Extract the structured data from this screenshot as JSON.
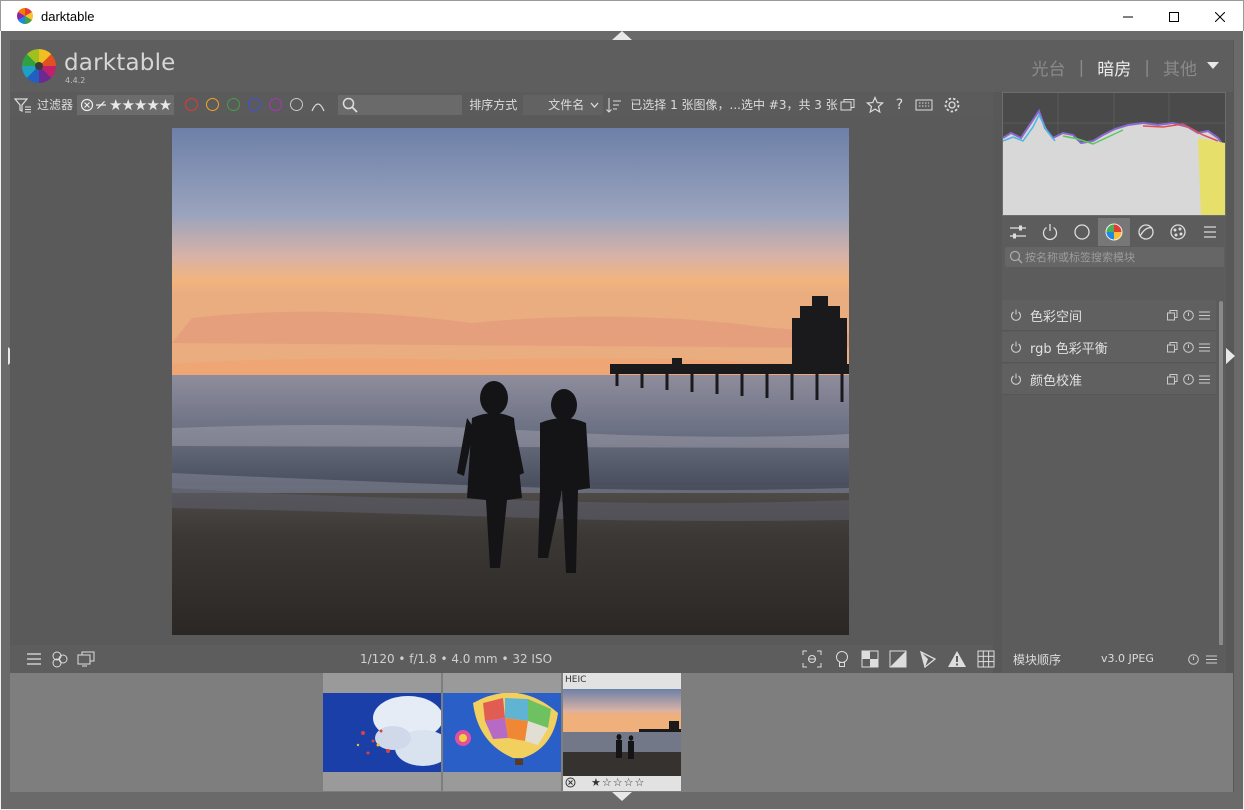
{
  "window": {
    "title": "darktable"
  },
  "header": {
    "logo_text": "darktable",
    "version": "4.4.2",
    "views": [
      {
        "label": "光台",
        "active": false
      },
      {
        "label": "暗房",
        "active": true
      },
      {
        "label": "其他",
        "active": false
      }
    ],
    "separator": "|"
  },
  "toolbar": {
    "filter_label": "过滤器",
    "rating_stars": "★★★★★",
    "search_placeholder": "",
    "sort_label": "排序方式",
    "sort_value": "文件名",
    "selection_info": "已选择 1 张图像，...选中 #3，共 3 张",
    "color_labels": [
      {
        "name": "red",
        "color": "#e53935"
      },
      {
        "name": "yellow",
        "color": "#f5a623"
      },
      {
        "name": "green",
        "color": "#43a047"
      },
      {
        "name": "blue",
        "color": "#3f51e5"
      },
      {
        "name": "purple",
        "color": "#b030c0"
      },
      {
        "name": "gray",
        "color": "#c8c8c8"
      }
    ]
  },
  "center": {
    "exif": "1/120 • f/1.8 • 4.0 mm • 32 ISO"
  },
  "right_panel": {
    "search_placeholder": "按名称或标签搜索模块",
    "modules": [
      {
        "label": "色彩空间"
      },
      {
        "label": "rgb 色彩平衡"
      },
      {
        "label": "颜色校准"
      }
    ],
    "module_order_label": "模块顺序",
    "module_order_value": "v3.0 JPEG"
  },
  "filmstrip": {
    "selected_badge": "HEIC",
    "selected_rating": "★☆☆☆☆"
  },
  "colors": {
    "panel_bg": "#585858",
    "text": "#dcdcdc",
    "accent_active_view": "#ededed"
  }
}
